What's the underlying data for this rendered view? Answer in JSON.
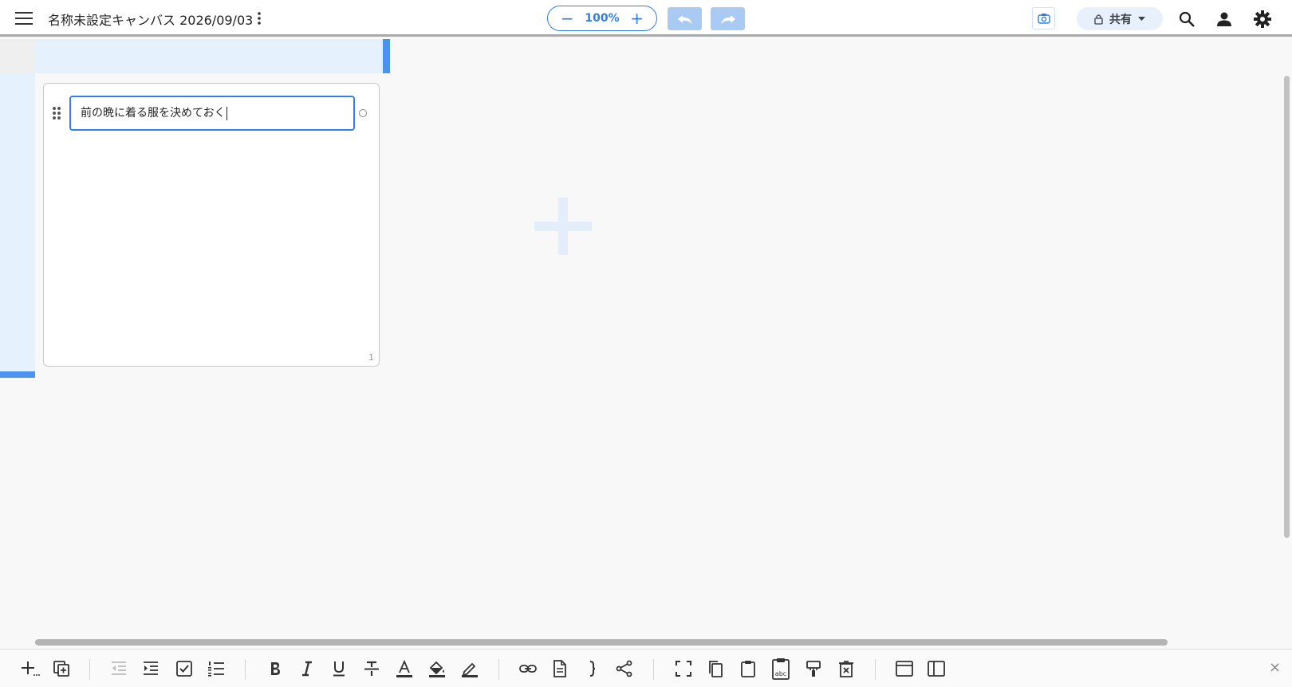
{
  "header": {
    "title": "名称未設定キャンバス 2026/09/03",
    "zoom": {
      "value": "100%",
      "minus": "−",
      "plus": "+"
    },
    "share": {
      "label": "共有"
    }
  },
  "card": {
    "task_text": "前の晩に着る服を決めておく",
    "count": "1"
  },
  "toolbar": {
    "close": "×"
  },
  "colors": {
    "accent": "#2f80e8",
    "history_buttons": "#a9cbf3",
    "selection_band": "#e5f2fd",
    "selection_marker": "#4b93ee"
  },
  "icons": [
    "menu-icon",
    "more-vert-icon",
    "undo-icon",
    "redo-icon",
    "camera-icon",
    "lock-icon",
    "dropdown-icon",
    "search-icon",
    "account-icon",
    "settings-icon",
    "drag-handle-icon",
    "add-icon"
  ]
}
